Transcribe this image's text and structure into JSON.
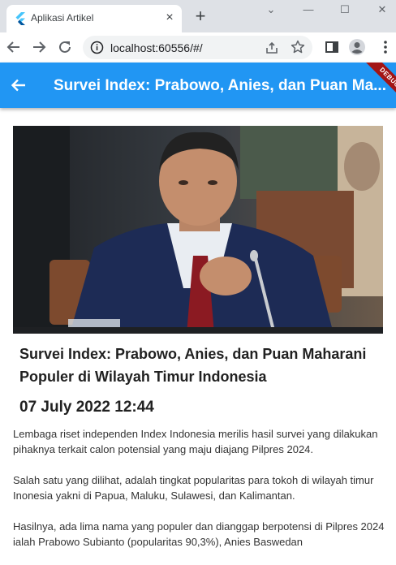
{
  "browser": {
    "tab_title": "Aplikasi Artikel",
    "tab_close": "×",
    "new_tab": "+",
    "window_controls": {
      "dropdown": "⌄",
      "minimize": "—",
      "maximize": "☐",
      "close": "✕"
    },
    "url": "localhost:60556/#/"
  },
  "appbar": {
    "title": "Survei Index: Prabowo, Anies, dan Puan Ma...",
    "debug_label": "DEBUG",
    "color": "#2196f3"
  },
  "article": {
    "title": "Survei Index: Prabowo, Anies, dan Puan Maharani Populer di Wilayah Timur Indonesia",
    "date": "07 July 2022 12:44",
    "paragraphs": [
      "Lembaga riset independen Index Indonesia merilis hasil survei yang dilakukan pihaknya terkait calon potensial yang maju diajang Pilpres 2024.",
      "Salah satu yang dilihat, adalah tingkat popularitas para tokoh di wilayah timur Inonesia yakni di Papua, Maluku, Sulawesi, dan Kalimantan.",
      "Hasilnya, ada lima nama yang populer dan dianggap berpotensi di Pilpres 2024 ialah Prabowo Subianto (popularitas 90,3%), Anies Baswedan"
    ]
  }
}
